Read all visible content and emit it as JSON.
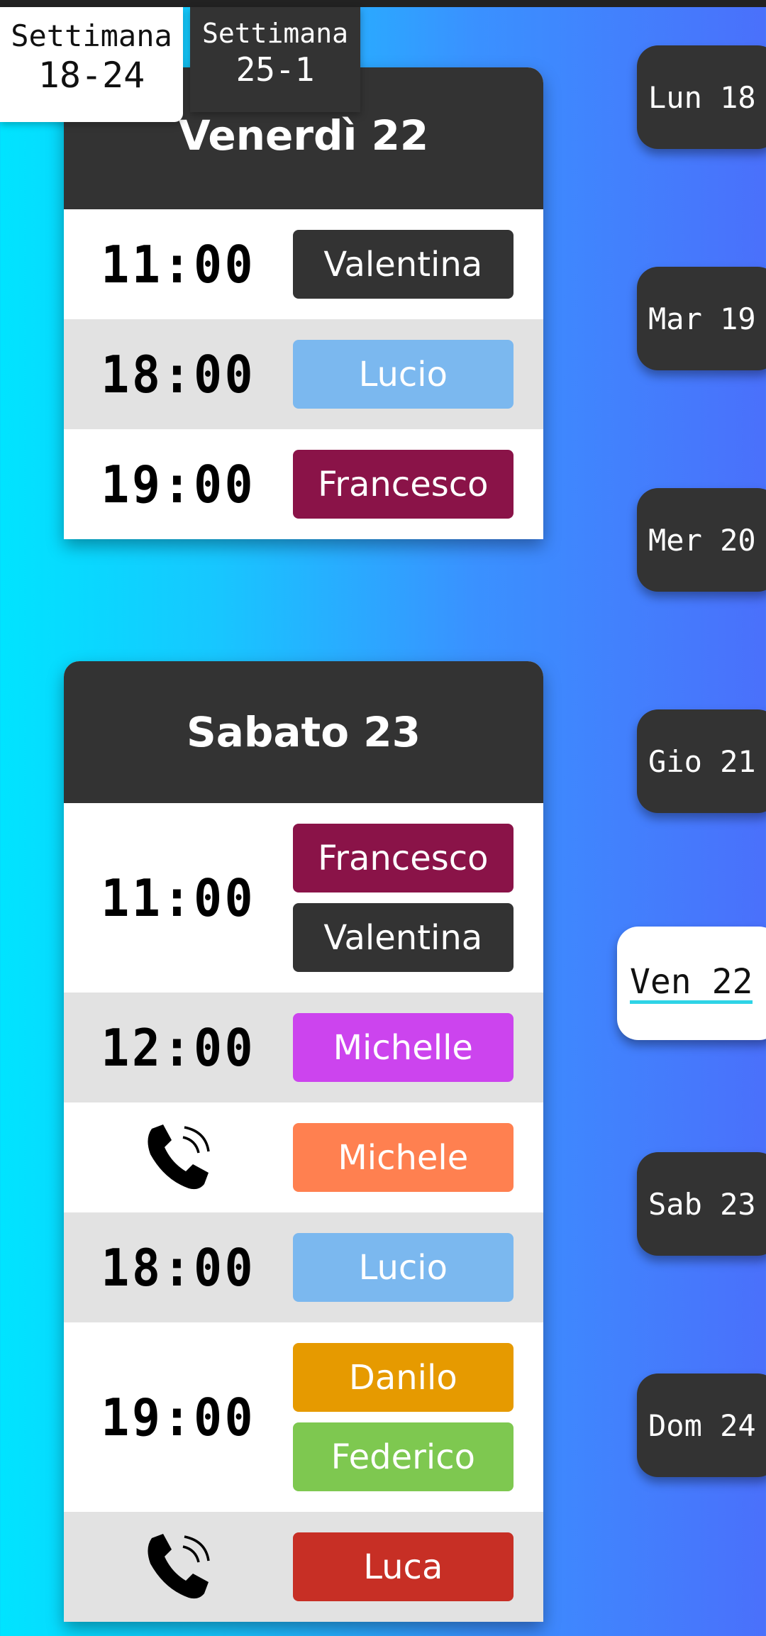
{
  "weeks": [
    {
      "line1": "Settimana",
      "line2": "18-24"
    },
    {
      "line1": "Settimana",
      "line2": "25-1"
    }
  ],
  "days": [
    {
      "title": "Venerdì 22",
      "rows": [
        {
          "time": "11:00",
          "names": [
            "Valentina"
          ],
          "colors": [
            "#333333"
          ]
        },
        {
          "time": "18:00",
          "names": [
            "Lucio"
          ],
          "colors": [
            "#7bb8ef"
          ]
        },
        {
          "time": "19:00",
          "names": [
            "Francesco"
          ],
          "colors": [
            "#8a1348"
          ]
        }
      ]
    },
    {
      "title": "Sabato 23",
      "rows": [
        {
          "time": "11:00",
          "names": [
            "Francesco",
            "Valentina"
          ],
          "colors": [
            "#8a1348",
            "#333333"
          ]
        },
        {
          "time": "12:00",
          "names": [
            "Michelle"
          ],
          "colors": [
            "#cc44ee"
          ]
        },
        {
          "time": "",
          "icon": "phone-icon",
          "names": [
            "Michele"
          ],
          "colors": [
            "#ff8050"
          ]
        },
        {
          "time": "18:00",
          "names": [
            "Lucio"
          ],
          "colors": [
            "#7bb8ef"
          ]
        },
        {
          "time": "19:00",
          "names": [
            "Danilo",
            "Federico"
          ],
          "colors": [
            "#e69a00",
            "#7ec850"
          ]
        },
        {
          "time": "",
          "icon": "phone-icon",
          "names": [
            "Luca"
          ],
          "colors": [
            "#c72f25"
          ]
        }
      ]
    }
  ],
  "day_nav": [
    "Lun 18",
    "Mar 19",
    "Mer 20",
    "Gio 21",
    "Ven 22",
    "Sab 23",
    "Dom 24"
  ],
  "active_day": "Ven 22"
}
